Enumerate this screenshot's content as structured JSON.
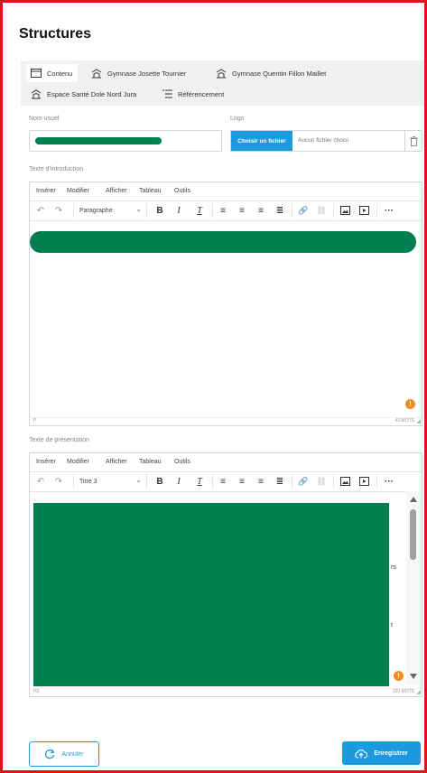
{
  "page": {
    "title": "Structures"
  },
  "tabs": [
    {
      "label": "Contenu",
      "icon": "window-icon",
      "active": true
    },
    {
      "label": "Gymnase Josette Tournier",
      "icon": "building-icon"
    },
    {
      "label": "Gymnase Quentin Fillon Maillet",
      "icon": "building-icon"
    },
    {
      "label": "Espace Santé Dole Nord Jura",
      "icon": "building-icon"
    },
    {
      "label": "Référencement",
      "icon": "list-icon"
    }
  ],
  "form": {
    "nom_usuel": {
      "label": "Nom usuel"
    },
    "logo": {
      "label": "Logo",
      "button": "Choisir un fichier",
      "status": "Aucun fichier choisi"
    }
  },
  "editors": [
    {
      "label": "Texte d'introduction",
      "menu": [
        "Insérer",
        "Modifier",
        "Afficher",
        "Tableau",
        "Outils"
      ],
      "block_format": "Paragraphe",
      "status_left": "P",
      "status_right": "43 MOTS",
      "visible_fragment": "...",
      "badge": "!"
    },
    {
      "label": "Texte de présentation",
      "menu": [
        "Insérer",
        "Modifier",
        "Afficher",
        "Tableau",
        "Outils"
      ],
      "block_format": "Titre 3",
      "status_left": "H3",
      "status_right": "203 MOTS",
      "visible_fragment_1": "rs",
      "visible_fragment_2": "t",
      "badge": "!"
    }
  ],
  "actions": {
    "cancel": "Annuler",
    "save": "Enregistrer"
  },
  "colors": {
    "accent": "#1c9ae0",
    "frame": "#e3111b",
    "redaction": "#00804e",
    "warning": "#f08a24"
  }
}
